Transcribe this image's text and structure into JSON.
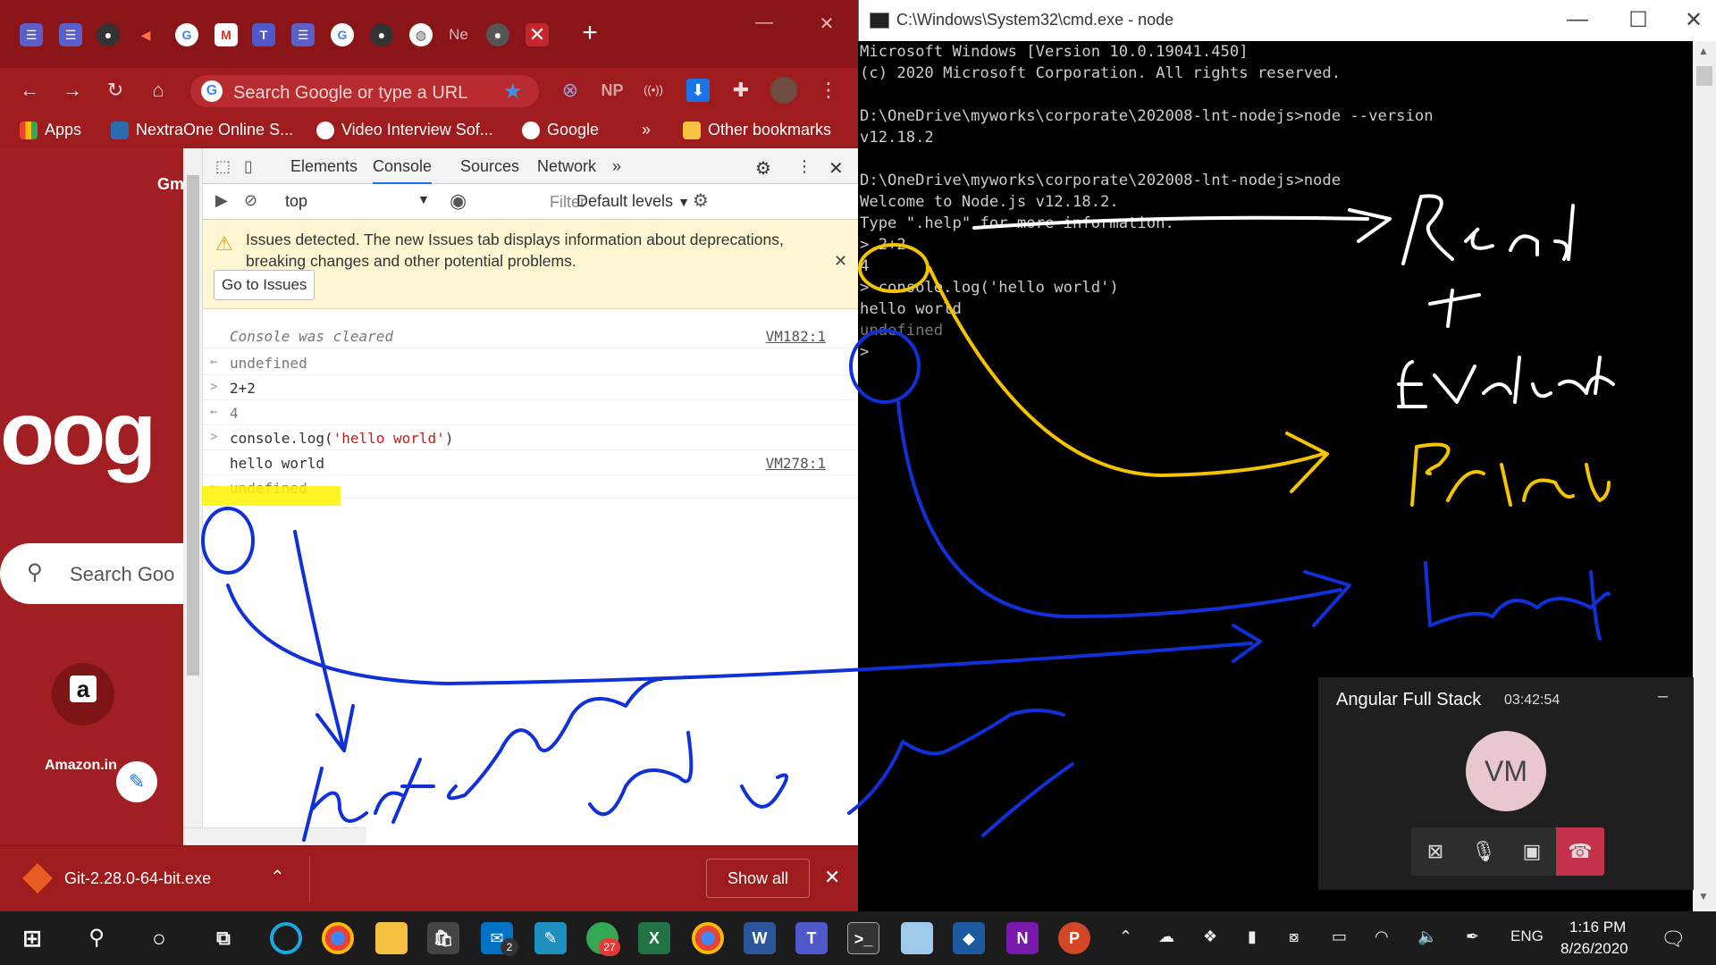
{
  "chrome": {
    "tabs_last_label": "Ne",
    "omnibox_placeholder": "Search Google or type a URL",
    "bookmarks": [
      "Apps",
      "NextraOne Online S...",
      "Video Interview Sof...",
      "Google"
    ],
    "bookmarks_overflow": "»",
    "other_bookmarks": "Other bookmarks",
    "extensions": {
      "np": "NP",
      "radio": "((•))"
    },
    "page": {
      "logo_fragment": "oog",
      "partial_header": "Gm",
      "search_placeholder": "Search Goo",
      "shortcut_label": "Amazon.in",
      "shortcut_icon_letter": "a"
    }
  },
  "devtools": {
    "tabs": [
      "Elements",
      "Console",
      "Sources",
      "Network",
      "»"
    ],
    "context": "top",
    "filter_placeholder": "Filter",
    "levels": "Default levels",
    "issues_text": "Issues detected. The new Issues tab displays information about deprecations, breaking changes and other potential problems.",
    "go_to_issues": "Go to Issues",
    "console": [
      {
        "gutter": "",
        "text": "Console was cleared",
        "src": "VM182:1",
        "italic": true
      },
      {
        "gutter": "←",
        "text": "undefined",
        "src": ""
      },
      {
        "gutter": ">",
        "text": "2+2",
        "src": ""
      },
      {
        "gutter": "←",
        "text": "4",
        "src": ""
      },
      {
        "gutter": ">",
        "text": "console.log('hello world')",
        "src": ""
      },
      {
        "gutter": "",
        "text": "hello world",
        "src": "VM278:1"
      },
      {
        "gutter": "←",
        "text": "undefined",
        "src": ""
      }
    ]
  },
  "downloads": {
    "file": "Git-2.28.0-64-bit.exe",
    "show_all": "Show all"
  },
  "cmd": {
    "title": "C:\\Windows\\System32\\cmd.exe - node",
    "lines": [
      "Microsoft Windows [Version 10.0.19041.450]",
      "(c) 2020 Microsoft Corporation. All rights reserved.",
      "",
      "D:\\OneDrive\\myworks\\corporate\\202008-lnt-nodejs>node --version",
      "v12.18.2",
      "",
      "D:\\OneDrive\\myworks\\corporate\\202008-lnt-nodejs>node",
      "Welcome to Node.js v12.18.2.",
      "Type \".help\" for more information.",
      "> 2+2",
      "4",
      "> console.log('hello world')",
      "hello world",
      "undefined",
      "> "
    ]
  },
  "meeting": {
    "title": "Angular Full Stack",
    "time": "03:42:54",
    "initials": "VM",
    "minimize": "–"
  },
  "taskbar": {
    "language": "ENG",
    "time": "1:16 PM",
    "date": "8/26/2020",
    "mail_badge": "2",
    "chrome_badge": "27"
  },
  "colors": {
    "chrome_red": "#9e1b1e",
    "ink_blue": "#1030d8",
    "ink_yellow": "#f5c400",
    "ink_white": "#ffffff",
    "highlight": "#fff200"
  }
}
